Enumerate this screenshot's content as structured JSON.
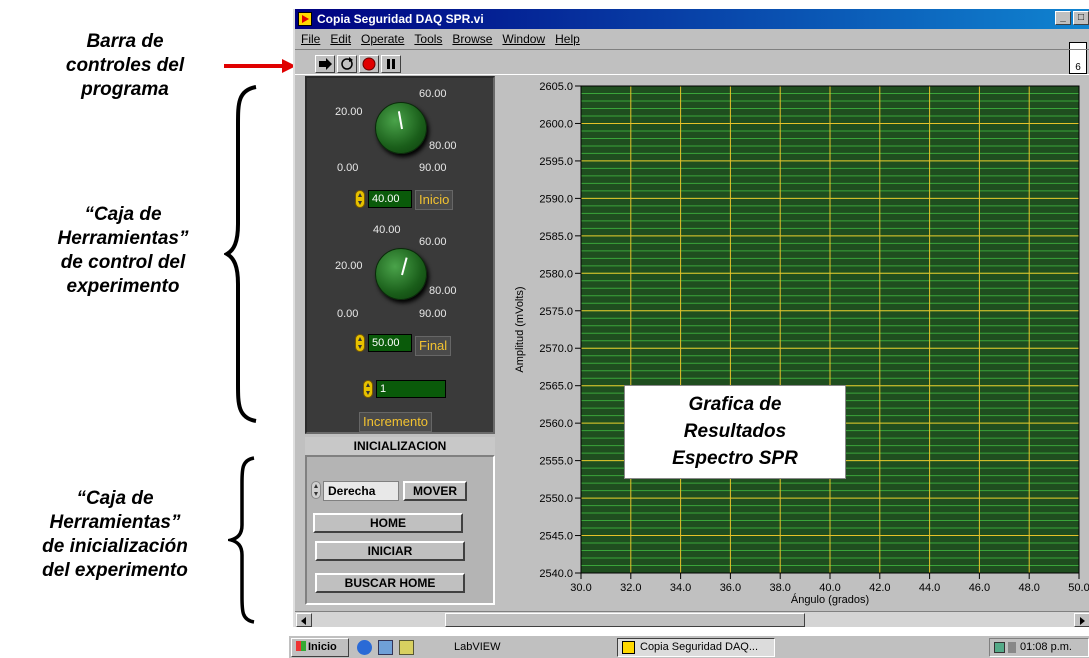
{
  "annotations": {
    "controls_bar": [
      "Barra de",
      "controles del",
      "programa"
    ],
    "experiment_toolbox": [
      "“Caja de",
      "Herramientas”",
      "de control  del",
      "experimento"
    ],
    "init_toolbox": [
      "“Caja de",
      "Herramientas”",
      "de inicialización",
      "del experimento"
    ],
    "chart_overlay": [
      "Grafica  de",
      "Resultados",
      "Espectro SPR"
    ]
  },
  "window": {
    "title": "Copia Seguridad DAQ SPR.vi",
    "menu": [
      "File",
      "Edit",
      "Operate",
      "Tools",
      "Browse",
      "Window",
      "Help"
    ],
    "corner_badge": "6"
  },
  "controls": {
    "knob1": {
      "labels": [
        "20.00",
        "60.00",
        "80.00",
        "0.00",
        "90.00"
      ],
      "value": 40.0
    },
    "start_value": "40.00",
    "start_label": "Inicio",
    "knob2": {
      "labels": [
        "40.00",
        "60.00",
        "20.00",
        "80.00",
        "0.00",
        "90.00"
      ],
      "value": 50.0
    },
    "end_value": "50.00",
    "end_label": "Final",
    "increment_value": "1",
    "increment_label": "Incremento"
  },
  "init": {
    "title": "INICIALIZACION",
    "direction": "Derecha",
    "move_button": "MOVER",
    "home_button": "HOME",
    "start_button": "INICIAR",
    "find_home_button": "BUSCAR HOME"
  },
  "chart_data": {
    "type": "line",
    "title": "",
    "xlabel": "Ángulo (grados)",
    "ylabel": "Amplitud (mVolts)",
    "xlim": [
      30.0,
      50.0
    ],
    "ylim": [
      2540.0,
      2605.0
    ],
    "x_ticks": [
      "30.0",
      "32.0",
      "34.0",
      "36.0",
      "38.0",
      "40.0",
      "42.0",
      "44.0",
      "46.0",
      "48.0",
      "50.0"
    ],
    "y_ticks": [
      "2540.0",
      "2545.0",
      "2550.0",
      "2555.0",
      "2560.0",
      "2565.0",
      "2570.0",
      "2575.0",
      "2580.0",
      "2585.0",
      "2590.0",
      "2595.0",
      "2600.0",
      "2605.0"
    ],
    "grid": true,
    "series": [],
    "colors": {
      "plot_bg": "#1f4e1f",
      "major_grid": "#e6c229",
      "minor_grid": "#3aa53a"
    }
  },
  "taskbar": {
    "start": "Inicio",
    "labview": "LabVIEW",
    "active_window": "Copia Seguridad DAQ...",
    "clock": "01:08 p.m."
  }
}
